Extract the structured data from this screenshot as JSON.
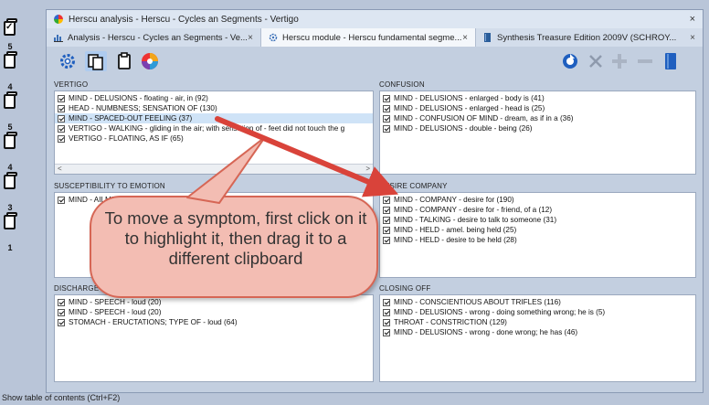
{
  "clipboards": [
    {
      "number": "",
      "checked": true
    },
    {
      "number": "5",
      "checked": false
    },
    {
      "number": "4",
      "checked": false
    },
    {
      "number": "5",
      "checked": false
    },
    {
      "number": "4",
      "checked": false
    },
    {
      "number": "3",
      "checked": false
    },
    {
      "number": "1",
      "checked": false
    }
  ],
  "window": {
    "title": "Herscu analysis - Herscu - Cycles an Segments - Vertigo",
    "close": "×"
  },
  "tabs": [
    {
      "label": "Analysis - Herscu - Cycles an Segments - Ve...",
      "icon": "bar-chart-icon",
      "active": false,
      "close": "×"
    },
    {
      "label": "Herscu module - Herscu fundamental segme...",
      "icon": "gear-icon",
      "active": true,
      "close": "×"
    },
    {
      "label": "Synthesis Treasure Edition 2009V (SCHROY...",
      "icon": "book-icon",
      "active": false,
      "close": "×"
    }
  ],
  "toolbar": {
    "left": [
      "settings-icon",
      "copy-clipboard-icon",
      "clipboard-icon",
      "color-wheel-icon"
    ],
    "right": [
      "refresh-icon",
      "remove-icon",
      "add-icon",
      "minus-icon",
      "book-icon"
    ]
  },
  "panels": {
    "vertigo": {
      "title": "VERTIGO",
      "rows": [
        "MIND - DELUSIONS - floating - air, in (92)",
        "HEAD - NUMBNESS; SENSATION OF (130)",
        "MIND - SPACED-OUT FEELING (37)",
        "VERTIGO - WALKING - gliding in the air; with sensation of - feet did not touch the g",
        "VERTIGO - FLOATING, AS IF (65)"
      ],
      "selected_index": 2,
      "scroll_left": "<",
      "scroll_right": ">"
    },
    "confusion": {
      "title": "CONFUSION",
      "rows": [
        "MIND - DELUSIONS - enlarged - body is (41)",
        "MIND - DELUSIONS - enlarged - head is (25)",
        "MIND - CONFUSION OF MIND - dream, as if in a (36)",
        "MIND - DELUSIONS - double - being (26)"
      ]
    },
    "susceptibility": {
      "title": "SUSCEPTIBILITY TO EMOTION",
      "rows": [
        "MIND - AILMENTS FROM - excitement - emotional (183)"
      ]
    },
    "desire_company": {
      "title": "DESIRE COMPANY",
      "rows": [
        "MIND - COMPANY - desire for (190)",
        "MIND - COMPANY - desire for - friend, of a (12)",
        "MIND - TALKING - desire to talk to someone (31)",
        "MIND - HELD - amel. being held (25)",
        "MIND - HELD - desire to be held (28)"
      ]
    },
    "discharge": {
      "title": "DISCHARGE",
      "rows": [
        "MIND - SPEECH - loud (20)",
        "MIND - SPEECH - loud (20)",
        "STOMACH - ERUCTATIONS; TYPE OF - loud (64)"
      ]
    },
    "closing_off": {
      "title": "CLOSING OFF",
      "rows": [
        "MIND - CONSCIENTIOUS ABOUT TRIFLES (116)",
        "MIND - DELUSIONS - wrong - doing something wrong; he is (5)",
        "THROAT - CONSTRICTION (129)",
        "MIND - DELUSIONS - wrong - done wrong; he has (46)"
      ]
    }
  },
  "callout": {
    "text": "To move a symptom, first click on it to highlight it, then drag it to a different clipboard"
  },
  "status": "Show table of contents (Ctrl+F2)",
  "colors": {
    "background": "#b9c5d8",
    "highlight": "#cfe3f7",
    "arrow": "#d9433a",
    "callout_fill": "#f3bdb3"
  }
}
